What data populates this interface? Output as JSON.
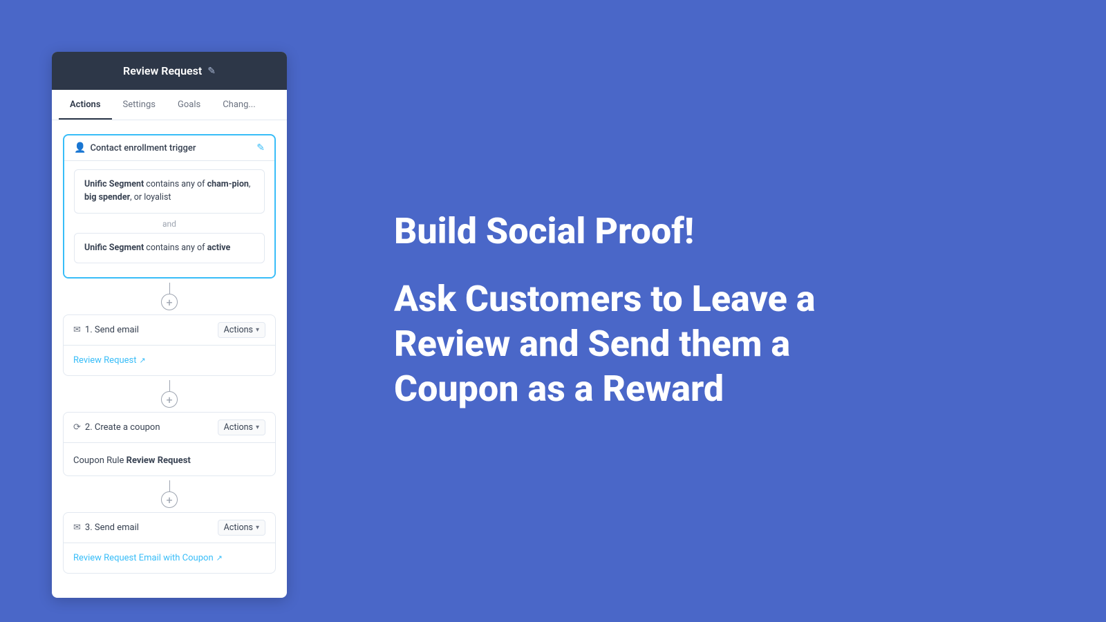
{
  "header": {
    "title": "Review Request",
    "edit_icon": "✎"
  },
  "tabs": [
    {
      "label": "Actions",
      "active": true
    },
    {
      "label": "Settings",
      "active": false
    },
    {
      "label": "Goals",
      "active": false
    },
    {
      "label": "Chang...",
      "active": false
    }
  ],
  "trigger": {
    "icon": "👤",
    "label": "Contact enrollment trigger",
    "edit_icon": "✎",
    "conditions": [
      {
        "text_parts": [
          {
            "type": "bold",
            "text": "Unific Segment"
          },
          {
            "type": "plain",
            "text": " contains any of "
          },
          {
            "type": "bold",
            "text": "cham-pion"
          },
          {
            "type": "plain",
            "text": ", "
          },
          {
            "type": "bold",
            "text": "big spender"
          },
          {
            "type": "plain",
            "text": ", or loyalist"
          }
        ]
      },
      {
        "text_parts": [
          {
            "type": "bold",
            "text": "Unific Segment"
          },
          {
            "type": "plain",
            "text": " contains any of "
          },
          {
            "type": "bold",
            "text": "active"
          }
        ]
      }
    ],
    "connector_and": "and"
  },
  "actions": [
    {
      "id": "action-1",
      "number": "1.",
      "type": "send_email",
      "icon": "✉",
      "label": "Send email",
      "actions_label": "Actions",
      "link_text": "Review Request",
      "link_url": "#",
      "has_link": true
    },
    {
      "id": "action-2",
      "number": "2.",
      "type": "create_coupon",
      "icon": "⟳",
      "label": "Create a coupon",
      "actions_label": "Actions",
      "body_text": "Coupon Rule",
      "body_bold": "Review Request",
      "has_link": false
    },
    {
      "id": "action-3",
      "number": "3.",
      "type": "send_email",
      "icon": "✉",
      "label": "Send email",
      "actions_label": "Actions",
      "link_text": "Review Request Email with Coupon",
      "link_url": "#",
      "has_link": true
    }
  ],
  "right": {
    "headline": "Build Social Proof!",
    "subheadline": "Ask Customers to Leave a Review and Send them a Coupon as a Reward"
  }
}
